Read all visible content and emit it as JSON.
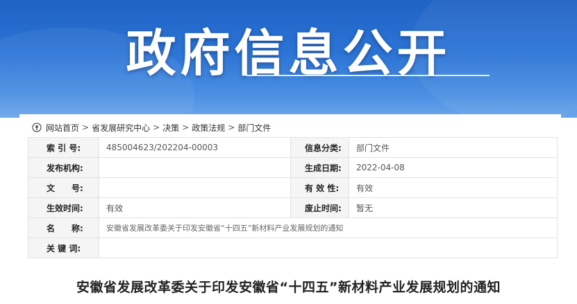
{
  "banner": {
    "title": "政府信息公开"
  },
  "breadcrumb": {
    "items": [
      "网站首页",
      "省发展研究中心",
      "决策",
      "政策法规",
      "部门文件"
    ],
    "separator": ">"
  },
  "meta": {
    "index_label": "索 引 号:",
    "index_value": "485004623/202204-00003",
    "category_label": "信息分类:",
    "category_value": "部门文件",
    "publisher_label": "发布机构:",
    "publisher_value": "",
    "date_label": "生成日期:",
    "date_value": "2022-04-08",
    "docno_label": "文　　号:",
    "docno_value": "",
    "validity_label": "有 效 性:",
    "validity_value": "有效",
    "effective_label": "生效时间:",
    "effective_value": "有效",
    "expire_label": "废止时间:",
    "expire_value": "暂无",
    "name_label": "名　　称:",
    "name_value": "安徽省发展改革委关于印发安徽省“十四五”新材料产业发展规划的通知",
    "keywords_label": "关 键 词:",
    "keywords_value": ""
  },
  "document": {
    "title": "安徽省发展改革委关于印发安徽省“十四五”新材料产业发展规划的通知"
  },
  "colors": {
    "banner_blue": "#2b74d6",
    "label_bg": "#f5f5f5",
    "border": "#e2e2e2"
  }
}
